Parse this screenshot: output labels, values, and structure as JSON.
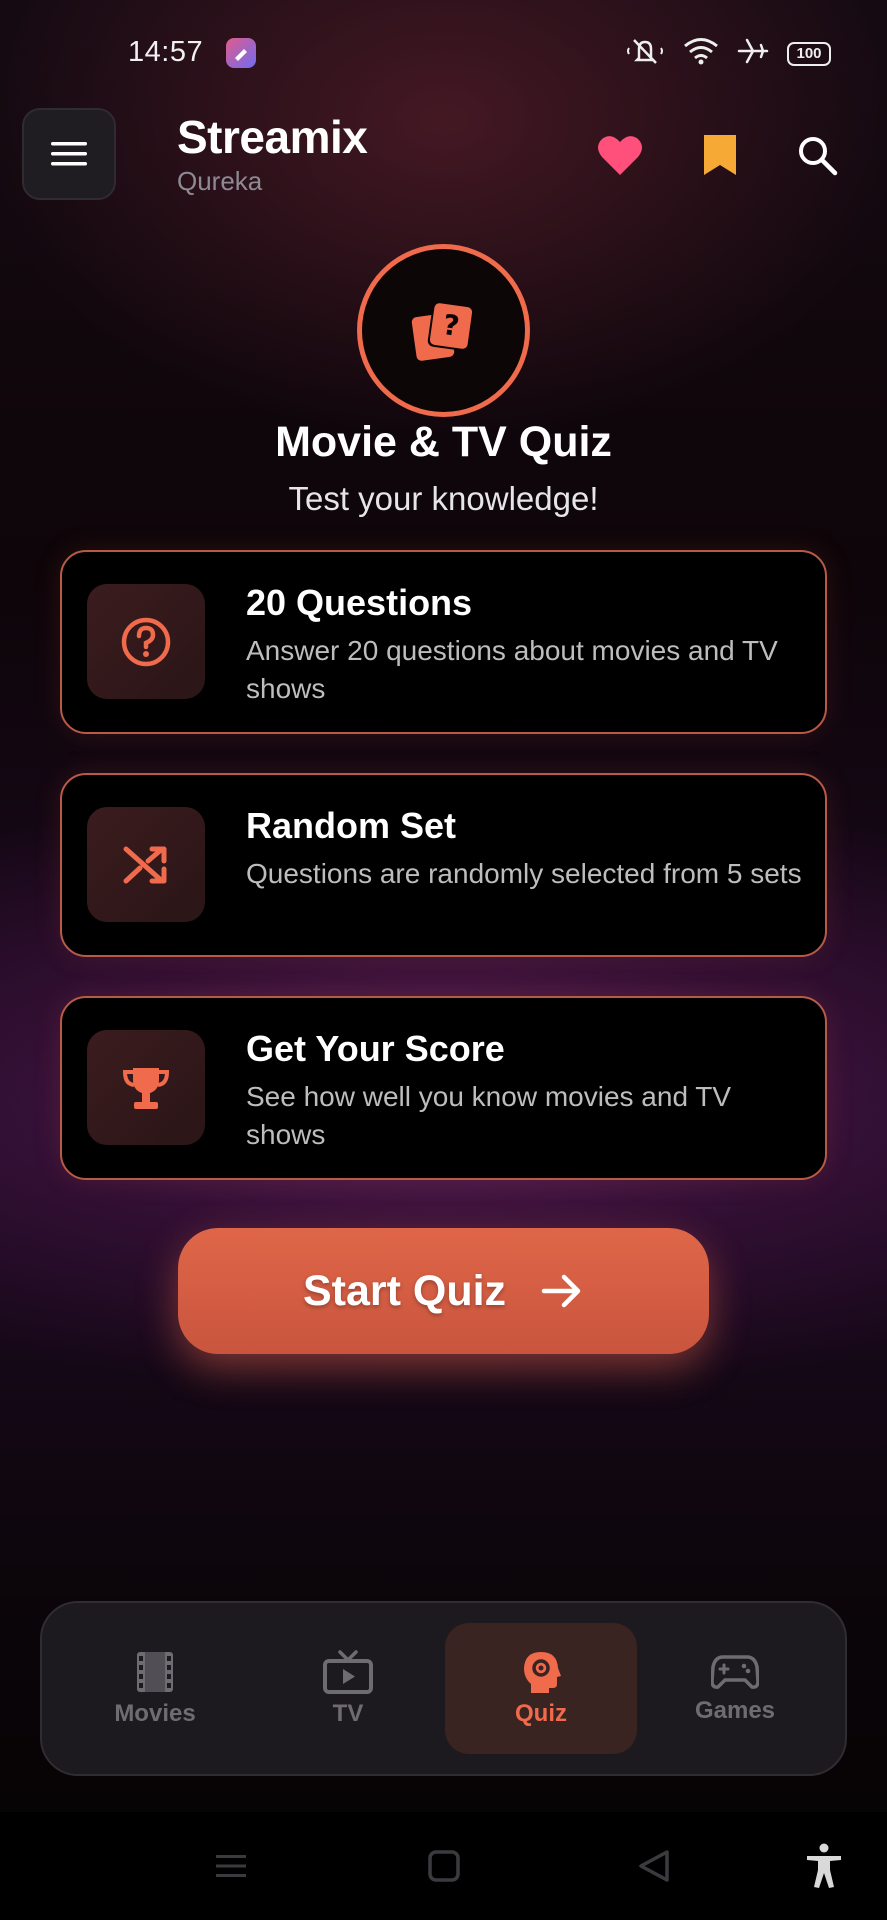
{
  "status_bar": {
    "time": "14:57",
    "battery": "100",
    "icons": [
      "mute-icon",
      "wifi-icon",
      "airplane-icon",
      "battery-icon"
    ]
  },
  "header": {
    "title": "Streamix",
    "subtitle": "Qureka",
    "icons": [
      "menu-icon",
      "heart-icon",
      "bookmark-icon",
      "search-icon"
    ]
  },
  "hero": {
    "icon": "quiz-cards-icon",
    "title": "Movie & TV Quiz",
    "subtitle": "Test your knowledge!"
  },
  "cards": [
    {
      "icon": "question-circle-icon",
      "title": "20 Questions",
      "description": "Answer 20 questions about movies and TV shows"
    },
    {
      "icon": "shuffle-icon",
      "title": "Random Set",
      "description": "Questions are randomly selected from 5 sets"
    },
    {
      "icon": "trophy-icon",
      "title": "Get Your Score",
      "description": "See how well you know movies and TV shows"
    }
  ],
  "start_button": {
    "label": "Start Quiz",
    "icon": "arrow-right-icon"
  },
  "bottom_nav": {
    "items": [
      {
        "label": "Movies",
        "icon": "film-icon",
        "active": false
      },
      {
        "label": "TV",
        "icon": "tv-icon",
        "active": false
      },
      {
        "label": "Quiz",
        "icon": "brain-head-icon",
        "active": true
      },
      {
        "label": "Games",
        "icon": "gamepad-icon",
        "active": false
      }
    ]
  },
  "colors": {
    "accent": "#f06a4c",
    "heart": "#ff4f7b",
    "bookmark": "#f7a936",
    "inactive": "#6f6b73"
  }
}
